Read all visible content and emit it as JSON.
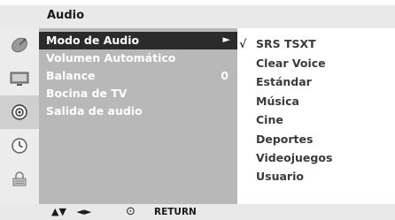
{
  "header": {
    "title": "Audio"
  },
  "sidebar": {
    "icons": [
      {
        "name": "satellite-dish-icon",
        "selected": false
      },
      {
        "name": "tv-picture-icon",
        "selected": false
      },
      {
        "name": "speaker-audio-icon",
        "selected": true
      },
      {
        "name": "clock-time-icon",
        "selected": false
      },
      {
        "name": "lock-option-icon",
        "selected": false
      }
    ]
  },
  "menu": {
    "items": [
      {
        "label": "Modo de Audio",
        "value": "",
        "arrow": "►",
        "selected": true
      },
      {
        "label": "Volumen Automático",
        "value": "",
        "arrow": "",
        "selected": false
      },
      {
        "label": "Balance",
        "value": "0",
        "arrow": "",
        "selected": false
      },
      {
        "label": "Bocina de TV",
        "value": "",
        "arrow": "",
        "selected": false
      },
      {
        "label": "Salida de audio",
        "value": "",
        "arrow": "",
        "selected": false
      }
    ]
  },
  "options": {
    "check_mark": "√",
    "items": [
      {
        "label": "SRS TSXT",
        "checked": true
      },
      {
        "label": "Clear Voice",
        "checked": false
      },
      {
        "label": "Estándar",
        "checked": false
      },
      {
        "label": "Música",
        "checked": false
      },
      {
        "label": "Cine",
        "checked": false
      },
      {
        "label": "Deportes",
        "checked": false
      },
      {
        "label": "Videojuegos",
        "checked": false
      },
      {
        "label": "Usuario",
        "checked": false
      }
    ]
  },
  "footer": {
    "nav_up_down": "▲▼",
    "nav_left_right": "◄►",
    "ok_symbol": "⊙",
    "return_label": "RETURN"
  },
  "colors": {
    "menu_bg": "#b8b8b8",
    "menu_selected": "#2b2b2b",
    "bar_bg": "#e9e9e9"
  }
}
